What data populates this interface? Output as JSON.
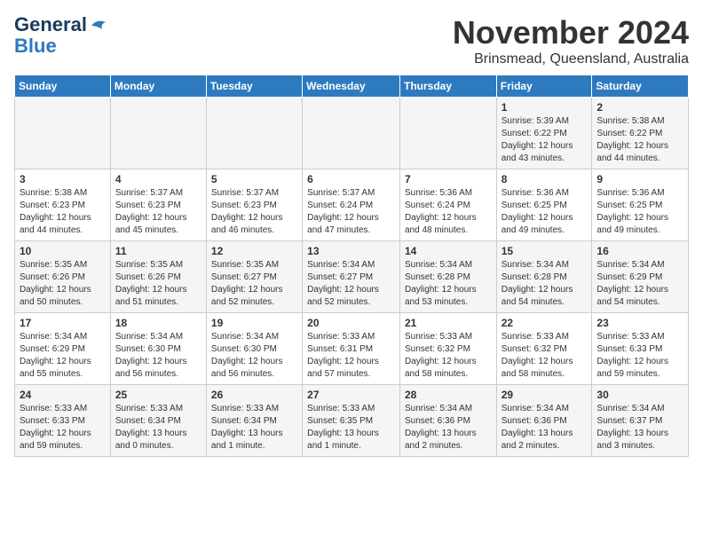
{
  "header": {
    "logo_line1": "General",
    "logo_line2": "Blue",
    "month_title": "November 2024",
    "location": "Brinsmead, Queensland, Australia"
  },
  "days_of_week": [
    "Sunday",
    "Monday",
    "Tuesday",
    "Wednesday",
    "Thursday",
    "Friday",
    "Saturday"
  ],
  "weeks": [
    [
      {
        "day": "",
        "info": ""
      },
      {
        "day": "",
        "info": ""
      },
      {
        "day": "",
        "info": ""
      },
      {
        "day": "",
        "info": ""
      },
      {
        "day": "",
        "info": ""
      },
      {
        "day": "1",
        "info": "Sunrise: 5:39 AM\nSunset: 6:22 PM\nDaylight: 12 hours\nand 43 minutes."
      },
      {
        "day": "2",
        "info": "Sunrise: 5:38 AM\nSunset: 6:22 PM\nDaylight: 12 hours\nand 44 minutes."
      }
    ],
    [
      {
        "day": "3",
        "info": "Sunrise: 5:38 AM\nSunset: 6:23 PM\nDaylight: 12 hours\nand 44 minutes."
      },
      {
        "day": "4",
        "info": "Sunrise: 5:37 AM\nSunset: 6:23 PM\nDaylight: 12 hours\nand 45 minutes."
      },
      {
        "day": "5",
        "info": "Sunrise: 5:37 AM\nSunset: 6:23 PM\nDaylight: 12 hours\nand 46 minutes."
      },
      {
        "day": "6",
        "info": "Sunrise: 5:37 AM\nSunset: 6:24 PM\nDaylight: 12 hours\nand 47 minutes."
      },
      {
        "day": "7",
        "info": "Sunrise: 5:36 AM\nSunset: 6:24 PM\nDaylight: 12 hours\nand 48 minutes."
      },
      {
        "day": "8",
        "info": "Sunrise: 5:36 AM\nSunset: 6:25 PM\nDaylight: 12 hours\nand 49 minutes."
      },
      {
        "day": "9",
        "info": "Sunrise: 5:36 AM\nSunset: 6:25 PM\nDaylight: 12 hours\nand 49 minutes."
      }
    ],
    [
      {
        "day": "10",
        "info": "Sunrise: 5:35 AM\nSunset: 6:26 PM\nDaylight: 12 hours\nand 50 minutes."
      },
      {
        "day": "11",
        "info": "Sunrise: 5:35 AM\nSunset: 6:26 PM\nDaylight: 12 hours\nand 51 minutes."
      },
      {
        "day": "12",
        "info": "Sunrise: 5:35 AM\nSunset: 6:27 PM\nDaylight: 12 hours\nand 52 minutes."
      },
      {
        "day": "13",
        "info": "Sunrise: 5:34 AM\nSunset: 6:27 PM\nDaylight: 12 hours\nand 52 minutes."
      },
      {
        "day": "14",
        "info": "Sunrise: 5:34 AM\nSunset: 6:28 PM\nDaylight: 12 hours\nand 53 minutes."
      },
      {
        "day": "15",
        "info": "Sunrise: 5:34 AM\nSunset: 6:28 PM\nDaylight: 12 hours\nand 54 minutes."
      },
      {
        "day": "16",
        "info": "Sunrise: 5:34 AM\nSunset: 6:29 PM\nDaylight: 12 hours\nand 54 minutes."
      }
    ],
    [
      {
        "day": "17",
        "info": "Sunrise: 5:34 AM\nSunset: 6:29 PM\nDaylight: 12 hours\nand 55 minutes."
      },
      {
        "day": "18",
        "info": "Sunrise: 5:34 AM\nSunset: 6:30 PM\nDaylight: 12 hours\nand 56 minutes."
      },
      {
        "day": "19",
        "info": "Sunrise: 5:34 AM\nSunset: 6:30 PM\nDaylight: 12 hours\nand 56 minutes."
      },
      {
        "day": "20",
        "info": "Sunrise: 5:33 AM\nSunset: 6:31 PM\nDaylight: 12 hours\nand 57 minutes."
      },
      {
        "day": "21",
        "info": "Sunrise: 5:33 AM\nSunset: 6:32 PM\nDaylight: 12 hours\nand 58 minutes."
      },
      {
        "day": "22",
        "info": "Sunrise: 5:33 AM\nSunset: 6:32 PM\nDaylight: 12 hours\nand 58 minutes."
      },
      {
        "day": "23",
        "info": "Sunrise: 5:33 AM\nSunset: 6:33 PM\nDaylight: 12 hours\nand 59 minutes."
      }
    ],
    [
      {
        "day": "24",
        "info": "Sunrise: 5:33 AM\nSunset: 6:33 PM\nDaylight: 12 hours\nand 59 minutes."
      },
      {
        "day": "25",
        "info": "Sunrise: 5:33 AM\nSunset: 6:34 PM\nDaylight: 13 hours\nand 0 minutes."
      },
      {
        "day": "26",
        "info": "Sunrise: 5:33 AM\nSunset: 6:34 PM\nDaylight: 13 hours\nand 1 minute."
      },
      {
        "day": "27",
        "info": "Sunrise: 5:33 AM\nSunset: 6:35 PM\nDaylight: 13 hours\nand 1 minute."
      },
      {
        "day": "28",
        "info": "Sunrise: 5:34 AM\nSunset: 6:36 PM\nDaylight: 13 hours\nand 2 minutes."
      },
      {
        "day": "29",
        "info": "Sunrise: 5:34 AM\nSunset: 6:36 PM\nDaylight: 13 hours\nand 2 minutes."
      },
      {
        "day": "30",
        "info": "Sunrise: 5:34 AM\nSunset: 6:37 PM\nDaylight: 13 hours\nand 3 minutes."
      }
    ]
  ]
}
